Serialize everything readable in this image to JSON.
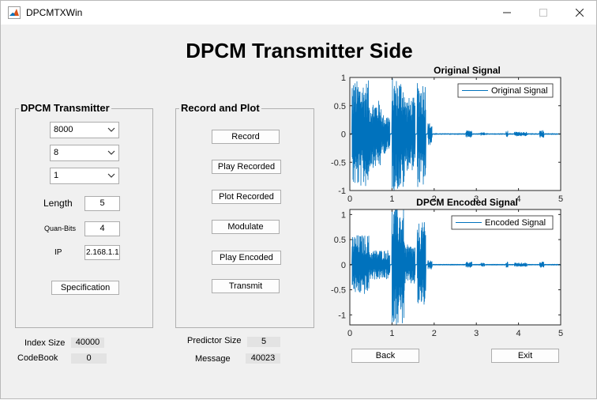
{
  "window": {
    "title": "DPCMTXWin"
  },
  "heading": "DPCM Transmitter Side",
  "transmitter": {
    "title": "DPCM Transmitter",
    "sample_rate": "8000",
    "bits": "8",
    "channels": "1",
    "length_label": "Length",
    "length_value": "5",
    "quan_label": "Quan-Bits",
    "quan_value": "4",
    "ip_label": "IP",
    "ip_value": "2.168.1.1",
    "spec_button": "Specification"
  },
  "record": {
    "title": "Record and Plot",
    "buttons": {
      "record": "Record",
      "play_recorded": "Play Recorded",
      "plot_recorded": "Plot Recorded",
      "modulate": "Modulate",
      "play_encoded": "Play Encoded",
      "transmit": "Transmit"
    }
  },
  "stats": {
    "index_size_label": "Index Size",
    "index_size_value": "40000",
    "codebook_label": "CodeBook",
    "codebook_value": "0",
    "predictor_label": "Predictor Size",
    "predictor_value": "5",
    "message_label": "Message",
    "message_value": "40023"
  },
  "nav": {
    "back": "Back",
    "exit": "Exit"
  },
  "chart_data": [
    {
      "type": "line",
      "title": "Original Signal",
      "legend": [
        "Original Signal"
      ],
      "legend_position": "top-right",
      "xlim": [
        0,
        5
      ],
      "ylim": [
        -1,
        1
      ],
      "xticks": [
        "0",
        "1",
        "2",
        "3",
        "4",
        "5"
      ],
      "yticks": [
        "1",
        "0.5",
        "0",
        "-0.5",
        "-1"
      ],
      "color": "#0072bd",
      "segments": [
        {
          "x": [
            0.05,
            0.45
          ],
          "amplitude": 0.95
        },
        {
          "x": [
            0.45,
            0.75
          ],
          "amplitude": 0.6
        },
        {
          "x": [
            0.75,
            0.95
          ],
          "amplitude": 0.35
        },
        {
          "x": [
            1.0,
            1.3
          ],
          "amplitude": 1.0
        },
        {
          "x": [
            1.3,
            1.55
          ],
          "amplitude": 0.65
        },
        {
          "x": [
            1.6,
            1.8
          ],
          "amplitude": 0.95
        },
        {
          "x": [
            1.85,
            1.95
          ],
          "amplitude": 0.2
        },
        {
          "x": [
            2.75,
            2.9
          ],
          "amplitude": 0.06
        },
        {
          "x": [
            3.1,
            3.2
          ],
          "amplitude": 0.03
        },
        {
          "x": [
            3.7,
            3.75
          ],
          "amplitude": 0.06
        },
        {
          "x": [
            3.9,
            4.2
          ],
          "amplitude": 0.04
        },
        {
          "x": [
            4.5,
            4.6
          ],
          "amplitude": 0.07
        }
      ]
    },
    {
      "type": "line",
      "title": "DPCM Encoded Signal",
      "legend": [
        "Encoded Signal"
      ],
      "legend_position": "top-right",
      "xlim": [
        0,
        5
      ],
      "ylim": [
        -1.2,
        1.1
      ],
      "xticks": [
        "0",
        "1",
        "2",
        "3",
        "4",
        "5"
      ],
      "yticks": [
        "1",
        "0.5",
        "0",
        "-0.5",
        "-1"
      ],
      "color": "#0072bd",
      "segments": [
        {
          "x": [
            0.05,
            0.45
          ],
          "amplitude": 0.6
        },
        {
          "x": [
            0.45,
            0.95
          ],
          "amplitude": 0.3
        },
        {
          "x": [
            1.0,
            1.3
          ],
          "amplitude": 1.2
        },
        {
          "x": [
            1.3,
            1.55
          ],
          "amplitude": 0.4
        },
        {
          "x": [
            1.6,
            1.8
          ],
          "amplitude": 0.85
        },
        {
          "x": [
            1.85,
            1.95
          ],
          "amplitude": 0.1
        },
        {
          "x": [
            2.75,
            2.9
          ],
          "amplitude": 0.06
        },
        {
          "x": [
            3.1,
            3.2
          ],
          "amplitude": 0.04
        },
        {
          "x": [
            3.7,
            3.75
          ],
          "amplitude": 0.06
        },
        {
          "x": [
            3.9,
            4.2
          ],
          "amplitude": 0.04
        },
        {
          "x": [
            4.5,
            4.6
          ],
          "amplitude": 0.06
        }
      ]
    }
  ]
}
